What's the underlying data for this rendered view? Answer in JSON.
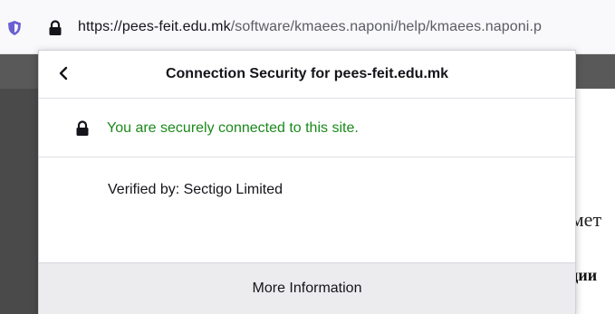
{
  "urlbar": {
    "url_host": "https://pees-feit.edu.mk",
    "url_path": "/software/kmaees.naponi/help/kmaees.naponi.p"
  },
  "page": {
    "fragment1": "смет",
    "fragment2": "ции"
  },
  "panel": {
    "title": "Connection Security for pees-feit.edu.mk",
    "secure_message": "You are securely connected to this site.",
    "verified_by": "Verified by: Sectigo Limited",
    "more_info_label": "More Information"
  },
  "colors": {
    "secure_green": "#1a8a1a",
    "shield_purple": "#6b5fd3"
  },
  "icons": [
    "shield-icon",
    "lock-icon",
    "back-chevron-icon",
    "secure-lock-icon"
  ]
}
